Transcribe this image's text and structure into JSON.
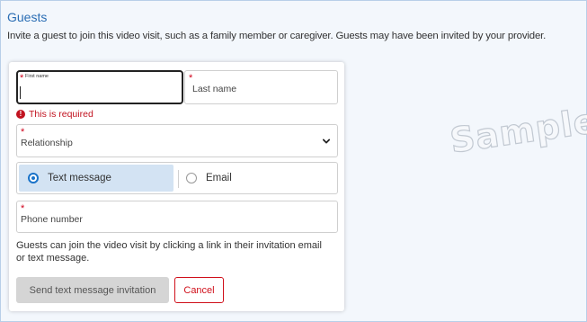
{
  "section": {
    "title": "Guests",
    "intro": "Invite a guest to join this video visit, such as a family member or caregiver. Guests may have been invited by your provider."
  },
  "form": {
    "first_name_label": "First name",
    "first_name_value": "",
    "last_name_label": "Last name",
    "error_text": "This is required",
    "relationship_label": "Relationship",
    "method_options": [
      {
        "label": "Text message",
        "selected": true
      },
      {
        "label": "Email",
        "selected": false
      }
    ],
    "phone_label": "Phone number",
    "note": "Guests can join the video visit by clicking a link in their invitation email or text message.",
    "send_label": "Send text message invitation",
    "cancel_label": "Cancel"
  },
  "watermark": "Sample",
  "colors": {
    "accent": "#1a73c9",
    "title": "#2a6db4",
    "error": "#c1121f",
    "selected_option_bg": "#d3e3f3",
    "panel_bg": "#f3f7fc"
  },
  "icons": {
    "error": "error-circle-icon",
    "dropdown": "chevron-down-icon",
    "radio": "radio-button-icon"
  }
}
